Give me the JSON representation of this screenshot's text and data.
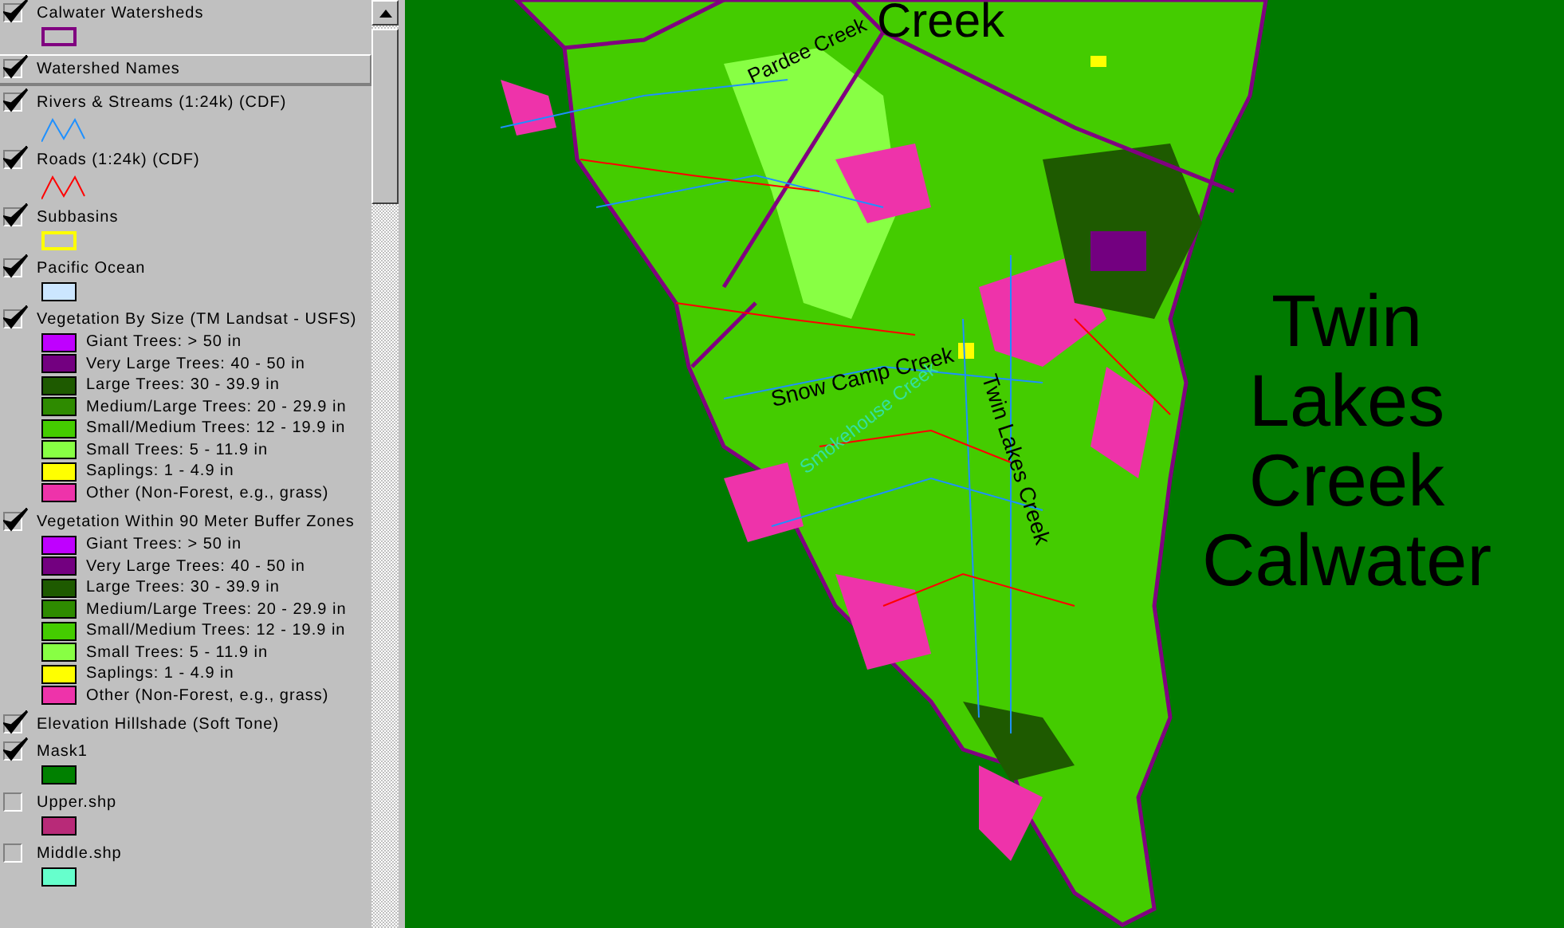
{
  "legend": {
    "layers": [
      {
        "title": "Calwater Watersheds",
        "checked": true,
        "selected": false,
        "symbol": {
          "kind": "outline",
          "color": "#800080"
        }
      },
      {
        "title": "Watershed Names",
        "checked": true,
        "selected": true
      },
      {
        "title": "Rivers & Streams (1:24k) (CDF)",
        "checked": true,
        "selected": false,
        "symbol": {
          "kind": "line",
          "color": "#1e90ff"
        }
      },
      {
        "title": "Roads (1:24k) (CDF)",
        "checked": true,
        "selected": false,
        "symbol": {
          "kind": "line",
          "color": "#ff0000"
        }
      },
      {
        "title": "Subbasins",
        "checked": true,
        "selected": false,
        "symbol": {
          "kind": "outline",
          "color": "#ffff00"
        }
      },
      {
        "title": "Pacific Ocean",
        "checked": true,
        "selected": false,
        "symbol": {
          "kind": "fill",
          "color": "#cce6ff"
        }
      },
      {
        "title": "Vegetation By Size (TM Landsat - USFS)",
        "checked": true,
        "selected": false,
        "classes": [
          {
            "label": "Giant Trees: > 50 in",
            "color": "#bf00ff"
          },
          {
            "label": "Very Large Trees: 40 - 50 in",
            "color": "#730080"
          },
          {
            "label": "Large Trees: 30 - 39.9 in",
            "color": "#1e5a00"
          },
          {
            "label": "Medium/Large Trees: 20 - 29.9 in",
            "color": "#2e8b00"
          },
          {
            "label": "Small/Medium Trees: 12 - 19.9 in",
            "color": "#44cc00"
          },
          {
            "label": "Small Trees: 5 - 11.9 in",
            "color": "#88ff44"
          },
          {
            "label": "Saplings: 1 - 4.9 in",
            "color": "#ffff00"
          },
          {
            "label": "Other (Non-Forest, e.g., grass)",
            "color": "#ee33aa"
          }
        ]
      },
      {
        "title": "Vegetation Within 90 Meter Buffer Zones",
        "checked": true,
        "selected": false,
        "classes": [
          {
            "label": "Giant Trees: > 50 in",
            "color": "#bf00ff"
          },
          {
            "label": "Very Large Trees: 40 - 50 in",
            "color": "#730080"
          },
          {
            "label": "Large Trees: 30 - 39.9 in",
            "color": "#1e5a00"
          },
          {
            "label": "Medium/Large Trees: 20 - 29.9 in",
            "color": "#2e8b00"
          },
          {
            "label": "Small/Medium Trees: 12 - 19.9 in",
            "color": "#44cc00"
          },
          {
            "label": "Small Trees: 5 - 11.9 in",
            "color": "#88ff44"
          },
          {
            "label": "Saplings: 1 - 4.9 in",
            "color": "#ffff00"
          },
          {
            "label": "Other (Non-Forest, e.g., grass)",
            "color": "#ee33aa"
          }
        ]
      },
      {
        "title": "Elevation Hillshade (Soft Tone)",
        "checked": true,
        "selected": false
      },
      {
        "title": "Mask1",
        "checked": true,
        "selected": false,
        "symbol": {
          "kind": "fill",
          "color": "#008000"
        }
      },
      {
        "title": "Upper.shp",
        "checked": false,
        "selected": false,
        "symbol": {
          "kind": "fill",
          "color": "#b82a78"
        }
      },
      {
        "title": "Middle.shp",
        "checked": false,
        "selected": false,
        "symbol": {
          "kind": "fill",
          "color": "#66ffcc"
        }
      }
    ]
  },
  "map": {
    "labels": [
      {
        "text": "Creek",
        "kind": "top"
      },
      {
        "text": "Pardee Creek",
        "kind": "pardee"
      },
      {
        "text": "Snow Camp Creek",
        "kind": "snow"
      },
      {
        "text": "Smokehouse Creek",
        "kind": "smoke"
      },
      {
        "text": "Twin Lakes Creek",
        "kind": "twin"
      }
    ],
    "title_lines": [
      "Twin",
      "Lakes",
      "Creek",
      "Calwater"
    ]
  }
}
